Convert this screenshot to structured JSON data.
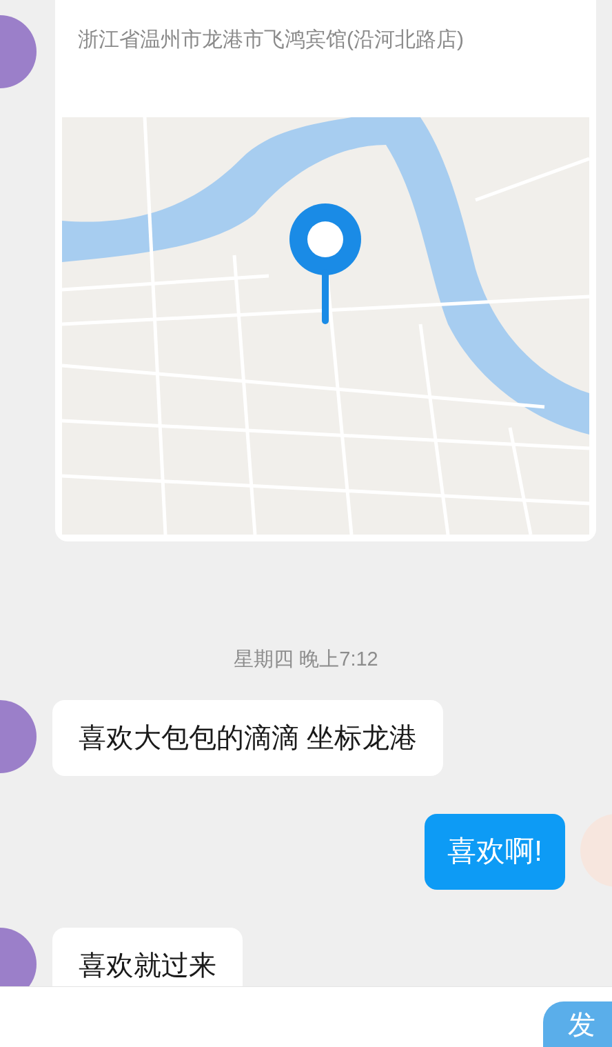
{
  "messages": [
    {
      "kind": "location",
      "outgoing": false,
      "address": "浙江省温州市龙港市飞鸿宾馆(沿河北路店)"
    },
    {
      "kind": "time",
      "text": "星期四 晚上7:12"
    },
    {
      "kind": "text",
      "outgoing": false,
      "text": "喜欢大包包的滴滴 坐标龙港"
    },
    {
      "kind": "text",
      "outgoing": true,
      "text": "喜欢啊!"
    },
    {
      "kind": "text",
      "outgoing": false,
      "text": "喜欢就过来"
    }
  ],
  "send_button": "发"
}
